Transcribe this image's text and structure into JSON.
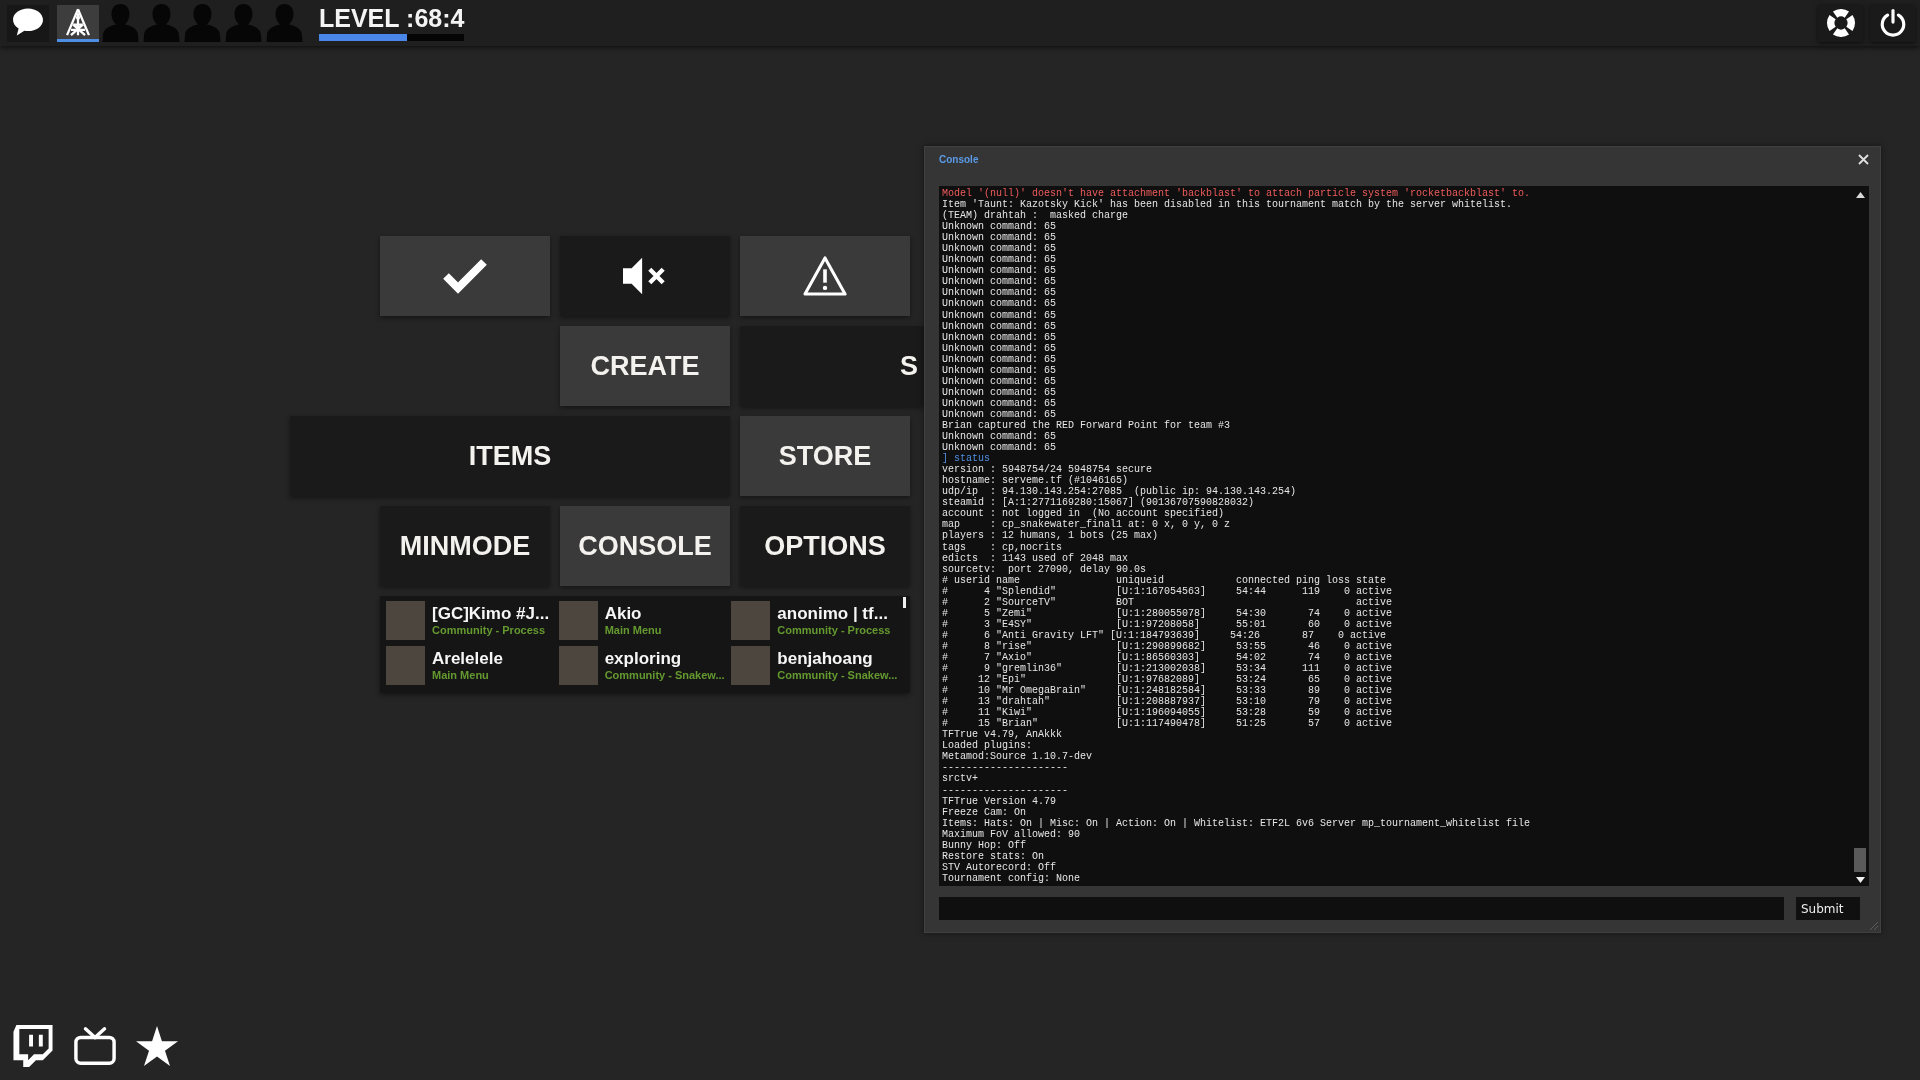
{
  "top_bar": {
    "tabs": [
      {
        "kind": "chat",
        "selected": false
      },
      {
        "kind": "tower",
        "selected": true
      }
    ],
    "party_slots": [
      {
        "occupied": false
      },
      {
        "occupied": false
      },
      {
        "occupied": false
      },
      {
        "occupied": false
      },
      {
        "occupied": false
      }
    ],
    "level": {
      "label": "LEVEL :68:4",
      "level": 0.61
    },
    "buttons": [
      {
        "kind": "lifebuoy"
      },
      {
        "kind": "power"
      }
    ]
  },
  "menu": {
    "buttons": [
      {
        "kind": "check",
        "highlighted": true
      },
      {
        "kind": "mute",
        "highlighted": false
      },
      {
        "kind": "warning",
        "highlighted": true
      },
      {
        "kind": "text",
        "label": "CREATE",
        "highlighted": true
      },
      {
        "kind": "text",
        "label": "S",
        "highlighted": false
      },
      {
        "kind": "text",
        "label": "ITEMS",
        "highlighted": false
      },
      {
        "kind": "text",
        "label": "STORE",
        "highlighted": true
      },
      {
        "kind": "text",
        "label": "MINMODE",
        "highlighted": false
      },
      {
        "kind": "text",
        "label": "CONSOLE",
        "highlighted": true
      },
      {
        "kind": "text",
        "label": "OPTIONS",
        "highlighted": false
      }
    ],
    "friends": [
      {
        "name": "[GC]Kimo #J...",
        "status": "Community - Process"
      },
      {
        "name": "Akio",
        "status": "Main Menu"
      },
      {
        "name": "anonimo | tf...",
        "status": "Community - Process"
      },
      {
        "name": "Arelelele",
        "status": "Main Menu"
      },
      {
        "name": "exploring",
        "status": "Community - Snakew..."
      },
      {
        "name": "benjahoang",
        "status": "Community - Snakew..."
      }
    ]
  },
  "console": {
    "title": "Console",
    "lines": [
      {
        "kind": "error",
        "text": "Model '(null)' doesn't have attachment 'backblast' to attach particle system 'rocketbackblast' to."
      },
      {
        "kind": "info",
        "text": "Item 'Taunt: Kazotsky Kick' has been disabled in this tournament match by the server whitelist."
      },
      {
        "kind": "info",
        "text": "(TEAM) drahtah :  masked charge"
      },
      {
        "kind": "info",
        "text": "Unknown command: 65"
      },
      {
        "kind": "info",
        "text": "Unknown command: 65"
      },
      {
        "kind": "info",
        "text": "Unknown command: 65"
      },
      {
        "kind": "info",
        "text": "Unknown command: 65"
      },
      {
        "kind": "info",
        "text": "Unknown command: 65"
      },
      {
        "kind": "info",
        "text": "Unknown command: 65"
      },
      {
        "kind": "info",
        "text": "Unknown command: 65"
      },
      {
        "kind": "info",
        "text": "Unknown command: 65"
      },
      {
        "kind": "info",
        "text": "Unknown command: 65"
      },
      {
        "kind": "info",
        "text": "Unknown command: 65"
      },
      {
        "kind": "info",
        "text": "Unknown command: 65"
      },
      {
        "kind": "info",
        "text": "Unknown command: 65"
      },
      {
        "kind": "info",
        "text": "Unknown command: 65"
      },
      {
        "kind": "info",
        "text": "Unknown command: 65"
      },
      {
        "kind": "info",
        "text": "Unknown command: 65"
      },
      {
        "kind": "info",
        "text": "Unknown command: 65"
      },
      {
        "kind": "info",
        "text": "Unknown command: 65"
      },
      {
        "kind": "info",
        "text": "Unknown command: 65"
      },
      {
        "kind": "info",
        "text": "Brian captured the RED Forward Point for team #3"
      },
      {
        "kind": "info",
        "text": "Unknown command: 65"
      },
      {
        "kind": "info",
        "text": "Unknown command: 65"
      },
      {
        "kind": "command",
        "text": "] status"
      },
      {
        "kind": "info",
        "text": "version : 5948754/24 5948754 secure"
      },
      {
        "kind": "info",
        "text": "hostname: serveme.tf (#1046165)"
      },
      {
        "kind": "info",
        "text": "udp/ip  : 94.130.143.254:27085  (public ip: 94.130.143.254)"
      },
      {
        "kind": "info",
        "text": "steamid : [A:1:2771169280:15067] (90136707590828032)"
      },
      {
        "kind": "info",
        "text": "account : not logged in  (No account specified)"
      },
      {
        "kind": "info",
        "text": "map     : cp_snakewater_final1 at: 0 x, 0 y, 0 z"
      },
      {
        "kind": "info",
        "text": "players : 12 humans, 1 bots (25 max)"
      },
      {
        "kind": "info",
        "text": "tags    : cp,nocrits"
      },
      {
        "kind": "info",
        "text": "edicts  : 1143 used of 2048 max"
      },
      {
        "kind": "info",
        "text": "sourcetv:  port 27090, delay 90.0s"
      },
      {
        "kind": "info",
        "text": "# userid name                uniqueid            connected ping loss state"
      },
      {
        "kind": "info",
        "text": "#      4 \"Splendid\"          [U:1:167054563]     54:44      119    0 active"
      },
      {
        "kind": "info",
        "text": "#      2 \"SourceTV\"          BOT                                     active"
      },
      {
        "kind": "info",
        "text": "#      5 \"Zemi\"              [U:1:280055078]     54:30       74    0 active"
      },
      {
        "kind": "info",
        "text": "#      3 \"E4SY\"              [U:1:97208058]      55:01       60    0 active"
      },
      {
        "kind": "info",
        "text": "#      6 \"Anti Gravity LFT\" [U:1:184793639]     54:26       87    0 active"
      },
      {
        "kind": "info",
        "text": "#      8 \"rise\"              [U:1:290899682]     53:55       46    0 active"
      },
      {
        "kind": "info",
        "text": "#      7 \"Axio\"              [U:1:86560303]      54:02       74    0 active"
      },
      {
        "kind": "info",
        "text": "#      9 \"gremlin36\"         [U:1:213002038]     53:34      111    0 active"
      },
      {
        "kind": "info",
        "text": "#     12 \"Epi\"               [U:1:97682089]      53:24       65    0 active"
      },
      {
        "kind": "info",
        "text": "#     10 \"Mr OmegaBrain\"     [U:1:248182584]     53:33       89    0 active"
      },
      {
        "kind": "info",
        "text": "#     13 \"drahtah\"           [U:1:208887937]     53:10       79    0 active"
      },
      {
        "kind": "info",
        "text": "#     11 \"Kiwi\"              [U:1:196094055]     53:28       59    0 active"
      },
      {
        "kind": "info",
        "text": "#     15 \"Brian\"             [U:1:117490478]     51:25       57    0 active"
      },
      {
        "kind": "info",
        "text": "TFTrue v4.79, AnAkkk"
      },
      {
        "kind": "info",
        "text": "Loaded plugins:"
      },
      {
        "kind": "info",
        "text": "Metamod:Source 1.10.7-dev"
      },
      {
        "kind": "info",
        "text": "---------------------"
      },
      {
        "kind": "info",
        "text": "srctv+"
      },
      {
        "kind": "info",
        "text": "---------------------"
      },
      {
        "kind": "info",
        "text": "TFTrue Version 4.79"
      },
      {
        "kind": "info",
        "text": "Freeze Cam: On"
      },
      {
        "kind": "info",
        "text": "Items: Hats: On | Misc: On | Action: On | Whitelist: ETF2L 6v6 Server mp_tournament_whitelist file"
      },
      {
        "kind": "info",
        "text": "Maximum FoV allowed: 90"
      },
      {
        "kind": "info",
        "text": "Bunny Hop: Off"
      },
      {
        "kind": "info",
        "text": "Restore stats: On"
      },
      {
        "kind": "info",
        "text": "STV Autorecord: Off"
      },
      {
        "kind": "info",
        "text": "Tournament config: None"
      }
    ],
    "submit": "Submit"
  },
  "bottom_bar": {
    "buttons": [
      {
        "kind": "speechbox"
      },
      {
        "kind": "tv"
      },
      {
        "kind": "star"
      }
    ]
  }
}
